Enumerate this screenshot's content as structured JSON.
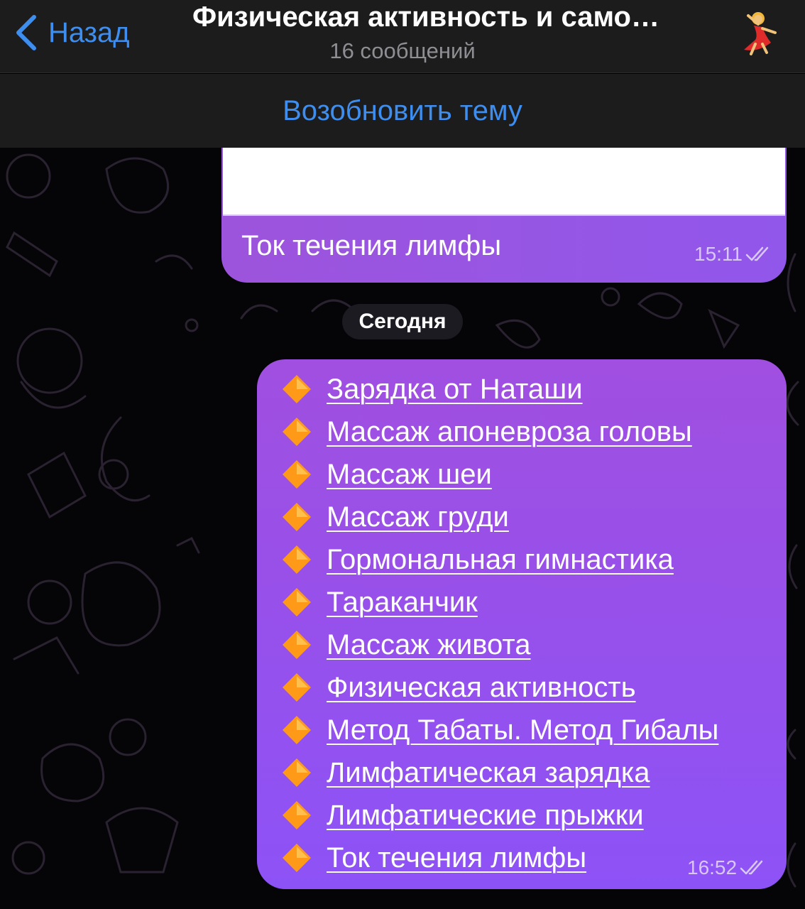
{
  "header": {
    "back_label": "Назад",
    "title": "Физическая активность и само…",
    "subtitle": "16 сообщений"
  },
  "resume_button": "Возобновить тему",
  "messages": {
    "first": {
      "text": "Ток течения лимфы",
      "time": "15:11"
    },
    "date_separator": "Сегодня",
    "second": {
      "links": [
        "Зарядка от Наташи",
        "Массаж апоневроза головы",
        "Массаж шеи",
        "Массаж груди ",
        "Гормональная гимнастика",
        "Тараканчик",
        "Массаж живота",
        "Физическая активность",
        "Метод Табаты. Метод Гибалы",
        "Лимфатическая зарядка",
        "Лимфатические прыжки",
        "Ток течения лимфы"
      ],
      "time": "16:52"
    }
  },
  "colors": {
    "accent": "#3e8ef0",
    "bubble": "#9157eb",
    "header_bg": "#1c1c1d"
  },
  "icons": [
    "chevron-left-icon",
    "dancer-avatar-icon",
    "orange-diamond-icon",
    "double-check-icon"
  ]
}
